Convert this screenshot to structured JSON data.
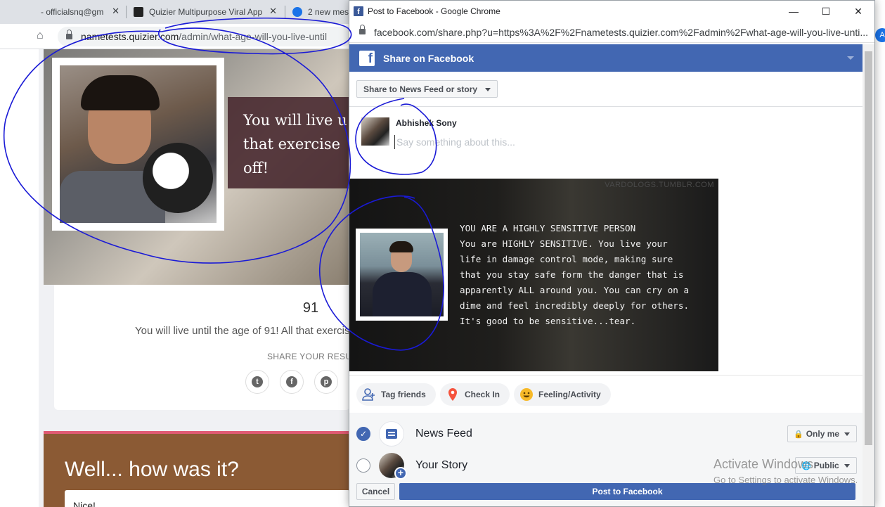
{
  "background_browser": {
    "tabs": [
      {
        "label": "- officialsnq@gm"
      },
      {
        "label": "Quizier Multipurpose Viral App"
      },
      {
        "label": "2 new mes"
      }
    ],
    "url_host": "nametests.quizier.com",
    "url_path": "/admin/what-age-will-you-live-until"
  },
  "quiz_page": {
    "banner_text": "You will live u\nthat exercise\noff!",
    "score": "91",
    "result_text": "You will live until the age of 91! All that exercis",
    "share_label": "SHARE YOUR RESUL",
    "social_buttons": [
      {
        "icon": "twitter-icon",
        "glyph": "t"
      },
      {
        "icon": "facebook-icon",
        "glyph": "f"
      },
      {
        "icon": "pinterest-icon",
        "glyph": "p"
      }
    ],
    "feedback_title": "Well... how was it?",
    "feedback_answer": "Nice!"
  },
  "popup": {
    "window_title": "Post to Facebook - Google Chrome",
    "address": "facebook.com/share.php?u=https%3A%2F%2Fnametests.quizier.com%2Fadmin%2Fwhat-age-will-you-live-unti...",
    "header_title": "Share on Facebook",
    "share_target_dropdown": "Share to News Feed or story",
    "user_name": "Abhishek Sony",
    "composer_placeholder": "Say something about this...",
    "preview": {
      "watermark": "VARDOLOGS.TUMBLR.COM",
      "text": "YOU ARE A HIGHLY SENSITIVE PERSON\nYou are HIGHLY SENSITIVE. You live your\nlife in damage control mode, making sure\nthat you stay safe form the danger that is\napparently ALL around you. You can cry on a\ndime and feel incredibly deeply for others.\nIt's good to be sensitive...tear."
    },
    "actions": [
      {
        "label": "Tag friends",
        "icon": "tag-friends-icon"
      },
      {
        "label": "Check In",
        "icon": "location-pin-icon"
      },
      {
        "label": "Feeling/Activity",
        "icon": "smiley-icon"
      }
    ],
    "targets": {
      "news_feed": {
        "label": "News Feed",
        "privacy": "Only me",
        "checked": true
      },
      "your_story": {
        "label": "Your Story",
        "privacy": "Public",
        "checked": false
      }
    },
    "cancel_label": "Cancel",
    "post_label": "Post to Facebook"
  },
  "right_avatar_letter": "A",
  "windows_watermark": {
    "title": "Activate Windows",
    "subtitle": "Go to Settings to activate Windows."
  },
  "colors": {
    "facebook_blue": "#4267b2",
    "annotation_ink": "#1a1ad6",
    "feedback_bg": "#8b5a34",
    "feedback_accent": "#e05a73"
  }
}
